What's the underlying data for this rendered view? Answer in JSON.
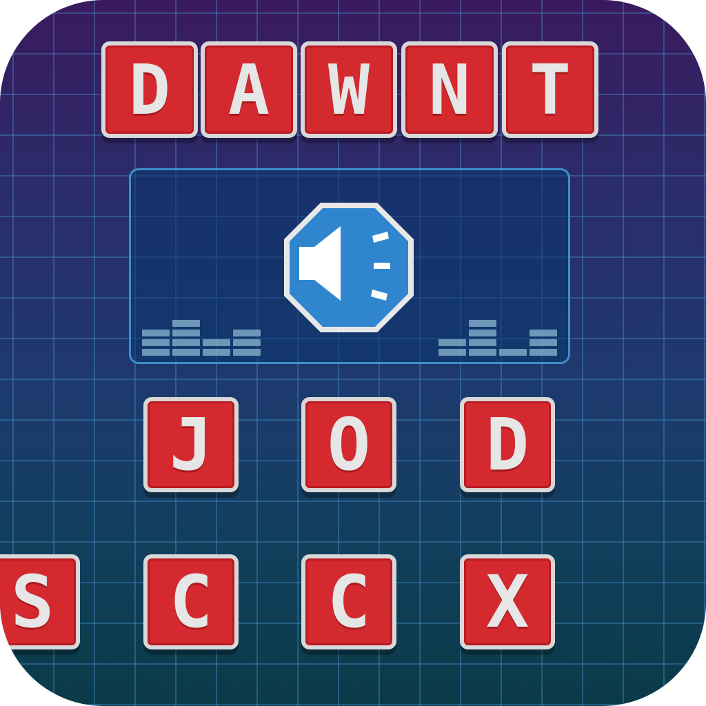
{
  "title_tiles": [
    "D",
    "A",
    "W",
    "N",
    "T"
  ],
  "answer_tiles": [
    "J",
    "O",
    "D"
  ],
  "letter_bank": [
    "S",
    "C",
    "C",
    "X"
  ],
  "clue": {
    "icon": "speaker-icon"
  },
  "colors": {
    "tile_red": "#d42a2f",
    "tile_border": "#d8d8d8",
    "speaker_blue": "#2f86cf",
    "grid_line": "#4696d2",
    "panel_border": "#3f8fc7"
  }
}
